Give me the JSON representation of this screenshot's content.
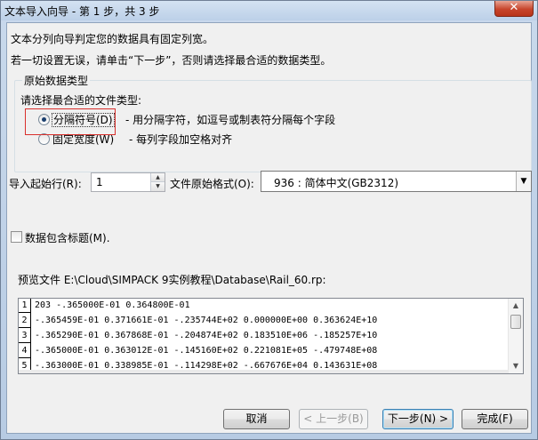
{
  "window": {
    "title": "文本导入向导 - 第 1 步，共 3 步",
    "close_glyph": "✕"
  },
  "intro": {
    "line1": "文本分列向导判定您的数据具有固定列宽。",
    "line2": "若一切设置无误，请单击“下一步”，否则请选择最合适的数据类型。"
  },
  "data_type_group": {
    "legend": "原始数据类型",
    "prompt": "请选择最合适的文件类型:",
    "options": [
      {
        "label": "分隔符号(D)",
        "description": "- 用分隔字符，如逗号或制表符分隔每个字段",
        "checked": true
      },
      {
        "label": "固定宽度(W)",
        "description": "- 每列字段加空格对齐",
        "checked": false
      }
    ]
  },
  "start_row": {
    "label": "导入起始行(R):",
    "value": "1"
  },
  "file_origin": {
    "label": "文件原始格式(O):",
    "value": "936 : 简体中文(GB2312)"
  },
  "header_checkbox": {
    "label": "数据包含标题(M).",
    "checked": false
  },
  "preview": {
    "label": "预览文件 E:\\Cloud\\SIMPACK 9实例教程\\Database\\Rail_60.rp:",
    "rows": [
      {
        "num": "1",
        "text": "203 -.365000E-01 0.364800E-01"
      },
      {
        "num": "2",
        "text": "-.365459E-01 0.371661E-01 -.235744E+02 0.000000E+00 0.363624E+10"
      },
      {
        "num": "3",
        "text": "-.365290E-01 0.367868E-01 -.204874E+02 0.183510E+06 -.185257E+10"
      },
      {
        "num": "4",
        "text": "-.365000E-01 0.363012E-01 -.145160E+02 0.221081E+05 -.479748E+08"
      },
      {
        "num": "5",
        "text": "-.363000E-01 0.338985E-01 -.114298E+02 -.667676E+04 0.143631E+08"
      }
    ]
  },
  "buttons": {
    "cancel": "取消",
    "back": "< 上一步(B)",
    "next": "下一步(N) >",
    "finish": "完成(F)"
  },
  "colors": {
    "focus_highlight": "#d9302c",
    "window_frame": "#b7cbe3",
    "close_button": "#c7452c"
  }
}
